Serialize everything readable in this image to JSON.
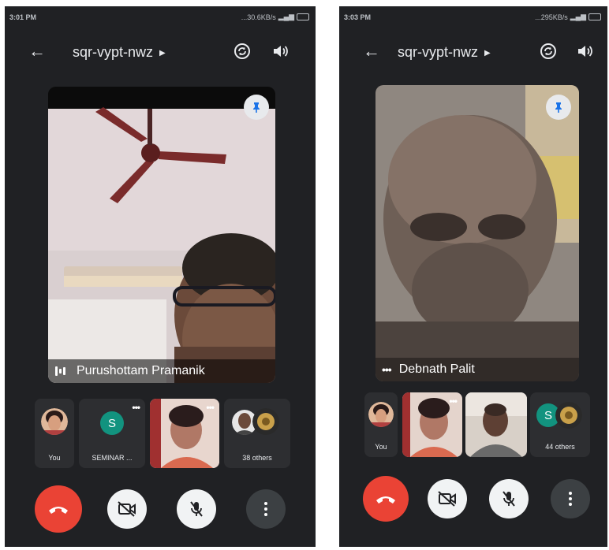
{
  "left": {
    "status": {
      "time": "3:01 PM",
      "net": "...30.6KB/s"
    },
    "meeting_code": "sqr-vypt-nwz",
    "main_speaker": "Purushottam Pramanik",
    "strip": {
      "you_label": "You",
      "participant_label": "SEMINAR ...",
      "participant_initial": "S",
      "others_label": "38 others"
    }
  },
  "right": {
    "status": {
      "time": "3:03 PM",
      "net": "...295KB/s"
    },
    "meeting_code": "sqr-vypt-nwz",
    "main_speaker": "Debnath Palit",
    "strip": {
      "you_label": "You",
      "others_initial": "S",
      "others_label": "44 others"
    }
  },
  "colors": {
    "bg": "#202124",
    "end_call": "#ea4335",
    "control_light": "#f1f3f4",
    "pin": "#1a73e8",
    "avatar_s": "#12937f"
  },
  "icons": [
    "back-arrow-icon",
    "caret-right-icon",
    "switch-camera-icon",
    "speaker-icon",
    "pin-icon",
    "audio-wave-icon",
    "more-dots-icon",
    "end-call-icon",
    "camera-off-icon",
    "mic-off-icon",
    "more-vert-icon"
  ]
}
